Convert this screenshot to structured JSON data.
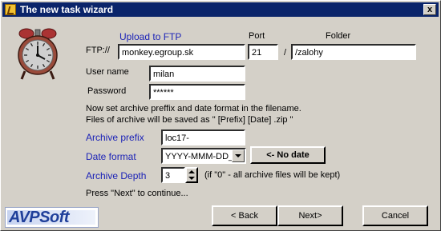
{
  "window": {
    "title": "The new task wizard",
    "close_label": "x"
  },
  "ftp": {
    "section_label": "Upload to FTP",
    "prefix_label": "FTP://",
    "host_value": "monkey.egroup.sk",
    "port_label": "Port",
    "port_value": "21",
    "separator": "/",
    "folder_label": "Folder",
    "folder_value": "/zalohy"
  },
  "credentials": {
    "username_label": "User name",
    "username_value": "milan",
    "password_label": "Password",
    "password_value": "******"
  },
  "info": {
    "line1": "Now set archive preffix and date format in the filename.",
    "line2": "Files of archive will be saved as \" [Prefix] [Date] .zip \""
  },
  "archive": {
    "prefix_label": "Archive prefix",
    "prefix_value": "loc17-",
    "date_format_label": "Date format",
    "date_format_value": "YYYY-MMM-DD_h",
    "no_date_button": "<- No date",
    "depth_label": "Archive Depth",
    "depth_value": "3",
    "depth_hint": "(if \"0\" - all archive files will be kept)"
  },
  "footer": {
    "continue_hint": "Press \"Next\" to continue...",
    "logo_text": "AVPSoft",
    "back_button": "< Back",
    "next_button": "Next>",
    "cancel_button": "Cancel"
  },
  "colors": {
    "titlebar": "#0a246a",
    "label_blue": "#1c23b7",
    "logo_blue": "#1f3f9a"
  },
  "icons": {
    "window": "wizard-icon",
    "clock": "alarm-clock-icon",
    "spinner": "spinner-icon"
  }
}
